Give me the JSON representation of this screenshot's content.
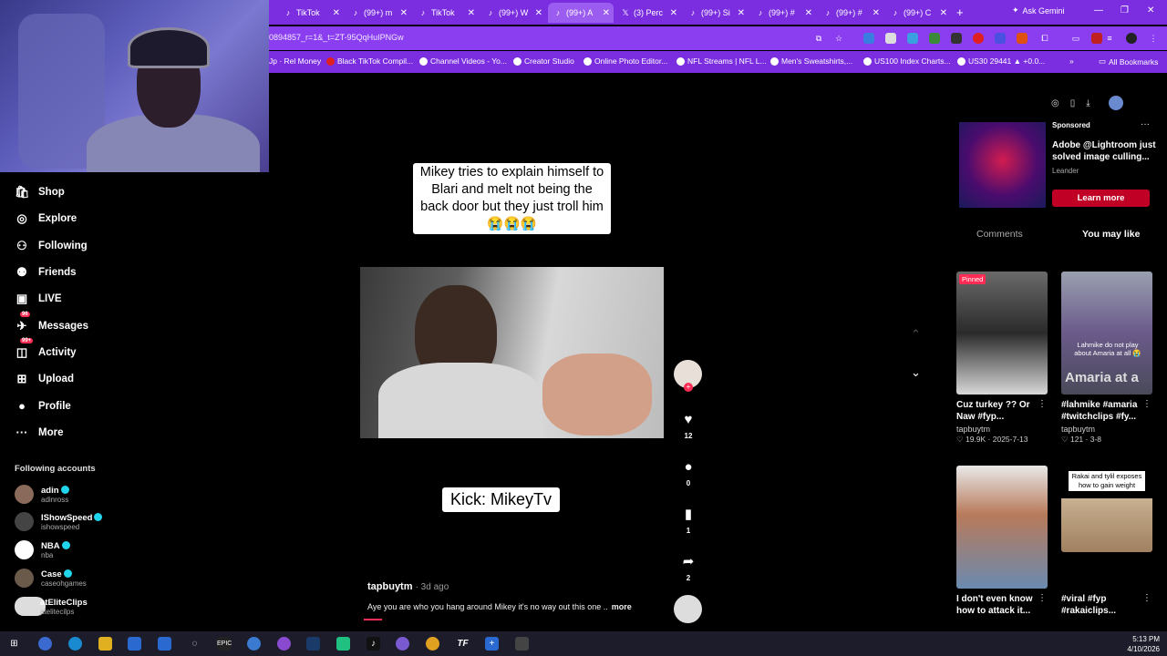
{
  "browser": {
    "tabs": [
      {
        "label": "TikTok",
        "icon": "tiktok-icon"
      },
      {
        "label": "(99+) m",
        "icon": "tiktok-icon"
      },
      {
        "label": "TikTok",
        "icon": "tiktok-icon"
      },
      {
        "label": "(99+) W",
        "icon": "tiktok-icon"
      },
      {
        "label": "(99+) A",
        "icon": "tiktok-icon",
        "active": true
      },
      {
        "label": "(3) Perc",
        "icon": "x-icon"
      },
      {
        "label": "(99+) Si",
        "icon": "tiktok-icon"
      },
      {
        "label": "(99+) #",
        "icon": "tiktok-icon"
      },
      {
        "label": "(99+) #",
        "icon": "tiktok-icon"
      },
      {
        "label": "(99+) C",
        "icon": "tiktok-icon"
      }
    ],
    "ask_gemini": "Ask Gemini",
    "url": "0894857_r=1&_t=ZT-95QqHuIPNGw",
    "bookmarks": [
      "Jp · Rel Money",
      "Black TikTok Compil...",
      "Channel Videos - Yo...",
      "Creator Studio",
      "Online Photo Editor...",
      "NFL Streams | NFL L...",
      "Men's Sweatshirts,...",
      "US100 Index Charts...",
      "US30 29441 ▲ +0.0..."
    ],
    "all_bookmarks": "All Bookmarks"
  },
  "sidebar": {
    "nav": [
      {
        "label": "Shop",
        "icon": "shop-icon"
      },
      {
        "label": "Explore",
        "icon": "compass-icon"
      },
      {
        "label": "Following",
        "icon": "following-icon"
      },
      {
        "label": "Friends",
        "icon": "friends-icon"
      },
      {
        "label": "LIVE",
        "icon": "live-icon"
      },
      {
        "label": "Messages",
        "icon": "messages-icon",
        "badge": "96"
      },
      {
        "label": "Activity",
        "icon": "activity-icon",
        "badge": "99+"
      },
      {
        "label": "Upload",
        "icon": "upload-icon"
      },
      {
        "label": "Profile",
        "icon": "profile-icon"
      },
      {
        "label": "More",
        "icon": "more-icon"
      }
    ],
    "following_title": "Following accounts",
    "accounts": [
      {
        "name": "adin",
        "handle": "adinross"
      },
      {
        "name": "IShowSpeed",
        "handle": "ishowspeed"
      },
      {
        "name": "NBA",
        "handle": "nba"
      },
      {
        "name": "Case",
        "handle": "caseohgames"
      },
      {
        "name": "atEliteClips",
        "handle": "atelitecilps"
      }
    ]
  },
  "video": {
    "caption": "Mikey tries to explain himself to Blari and melt not being the back door but they just troll him😭😭😭",
    "overlay_text": "Kick: MikeyTv",
    "author": "tapbuytm",
    "posted": "· 3d ago",
    "description": "Aye you are who you hang around Mikey it's no way out this one ..",
    "more": "more",
    "progress": 0.06,
    "actions": {
      "likes": "12",
      "comments": "0",
      "saves": "1",
      "shares": "2"
    }
  },
  "ad": {
    "sponsored": "Sponsored",
    "title": "Adobe @Lightroom just solved image culling...",
    "sub": "Leander",
    "cta": "Learn more"
  },
  "panel_tabs": {
    "comments": "Comments",
    "you_may_like": "You may like"
  },
  "cards": [
    {
      "title": "Cuz turkey ?? Or Naw #fyp...",
      "user": "tapbuytm",
      "stats": "♡ 19.9K · 2025-7-13",
      "pinned": "Pinned"
    },
    {
      "title": "#lahmike #amaria #twitchclips #fy...",
      "user": "tapbuytm",
      "stats": "♡ 121 · 3-8",
      "overlay": "Lahmike do not play about Amaria at all 😭",
      "overlay2": "Amaria at a"
    },
    {
      "title": "I don't even know how to attack it...",
      "user": "",
      "stats": ""
    },
    {
      "title": "#viral #fyp #rakaiclips...",
      "user": "",
      "stats": "",
      "overlay": "Rakai and tylil exposes how to gain weight"
    }
  ],
  "taskbar": {
    "time": "5:13 PM",
    "date": "4/10/2026"
  }
}
